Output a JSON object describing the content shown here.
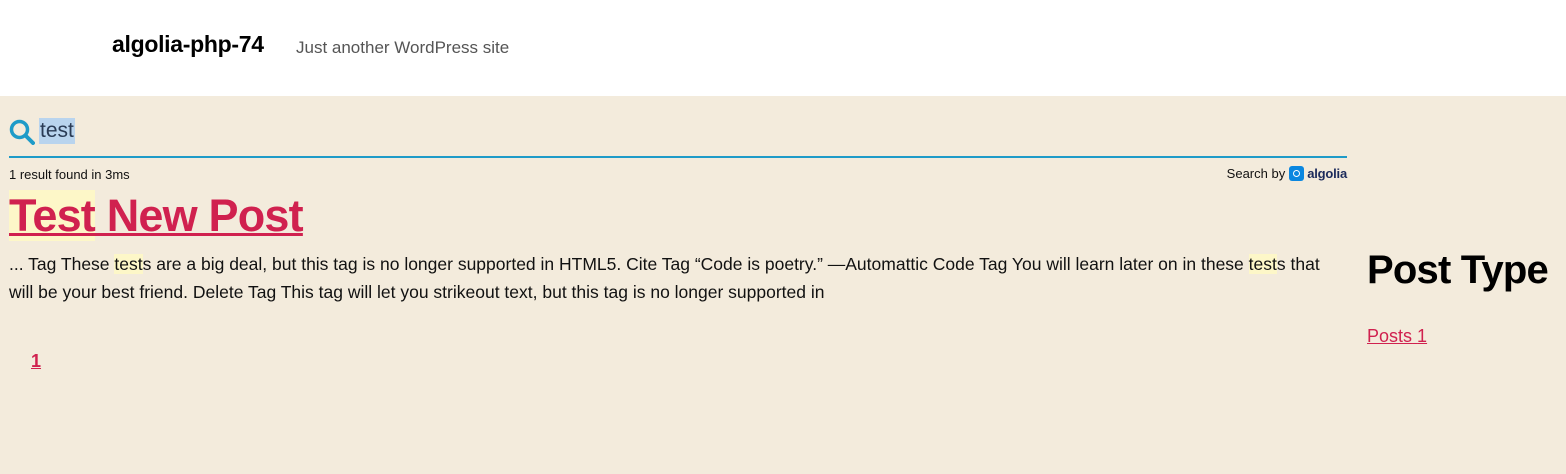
{
  "header": {
    "site_title": "algolia-php-74",
    "tagline": "Just another WordPress site"
  },
  "search": {
    "value": "test",
    "stats": "1 result found in 3ms",
    "search_by_label": "Search by",
    "provider": "algolia"
  },
  "result": {
    "title_highlight": "Test",
    "title_rest": " New Post",
    "snippet_parts": [
      {
        "text": "... Tag These ",
        "hl": false
      },
      {
        "text": "test",
        "hl": true
      },
      {
        "text": "s are a big deal, but this tag is no longer supported in HTML5. Cite Tag “Code is poetry.” —Automattic Code Tag You will learn later on in these ",
        "hl": false
      },
      {
        "text": "test",
        "hl": true
      },
      {
        "text": "s that will be your best friend. Delete Tag This tag will let you strikeout text, but this tag is no longer supported in",
        "hl": false
      }
    ]
  },
  "pagination": {
    "current": "1"
  },
  "sidebar": {
    "heading": "Post Type",
    "facets": [
      {
        "label": "Posts",
        "count": "1"
      }
    ]
  },
  "colors": {
    "link": "#d0214f",
    "accent": "#1e9bc8",
    "highlight": "#fdf7c8",
    "background": "#f3ebdc"
  }
}
